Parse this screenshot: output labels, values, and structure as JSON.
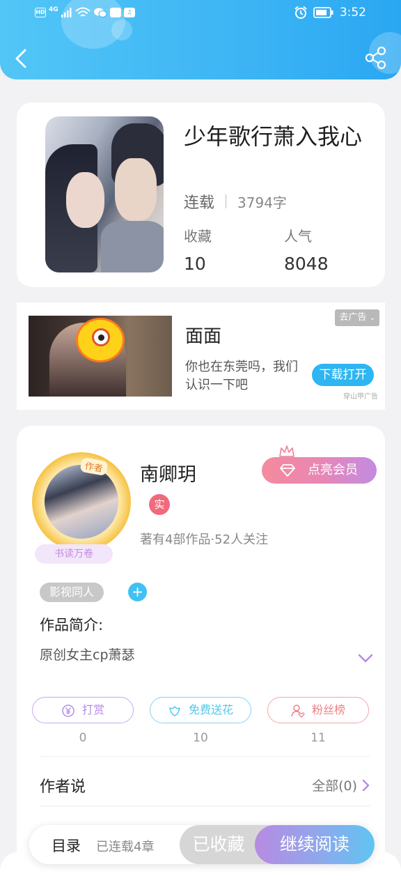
{
  "status_bar": {
    "left_icons": [
      "hd-icon",
      "4g-signal-icon",
      "wifi-icon",
      "wechat-icon",
      "cloud-app-icon",
      "music-app-icon"
    ],
    "hd_label": "HD",
    "network_label": "4G",
    "time": "3:52"
  },
  "book": {
    "title": "少年歌行萧入我心",
    "status": "连载",
    "word_count": "3794字",
    "favorites_label": "收藏",
    "favorites": "10",
    "popularity_label": "人气",
    "popularity": "8048"
  },
  "ad": {
    "title": "面面",
    "description": "你也在东莞吗，我们认识一下吧",
    "close_label": "去广告",
    "action_label": "下载打开",
    "source": "穿山甲广告"
  },
  "author": {
    "avatar_tag": "作者",
    "badge": "书读万卷",
    "name": "南卿玥",
    "real_badge": "实",
    "stats": "著有4部作品·52人关注",
    "vip_label": "点亮会员",
    "tag": "影视同人",
    "intro_title": "作品简介:",
    "intro": "原创女主cp萧瑟"
  },
  "actions": [
    {
      "label": "打赏",
      "count": "0",
      "color": "#b58be6",
      "icon": "yen-icon"
    },
    {
      "label": "免费送花",
      "count": "10",
      "color": "#4ec8ee",
      "icon": "flower-icon"
    },
    {
      "label": "粉丝榜",
      "count": "11",
      "color": "#f07f86",
      "icon": "fan-rank-icon"
    }
  ],
  "author_say": {
    "title": "作者说",
    "all_label": "全部(0)"
  },
  "bottom": {
    "toc_label": "目录",
    "toc_sub": "已连载4章",
    "collected_label": "已收藏",
    "read_label": "继续阅读"
  }
}
